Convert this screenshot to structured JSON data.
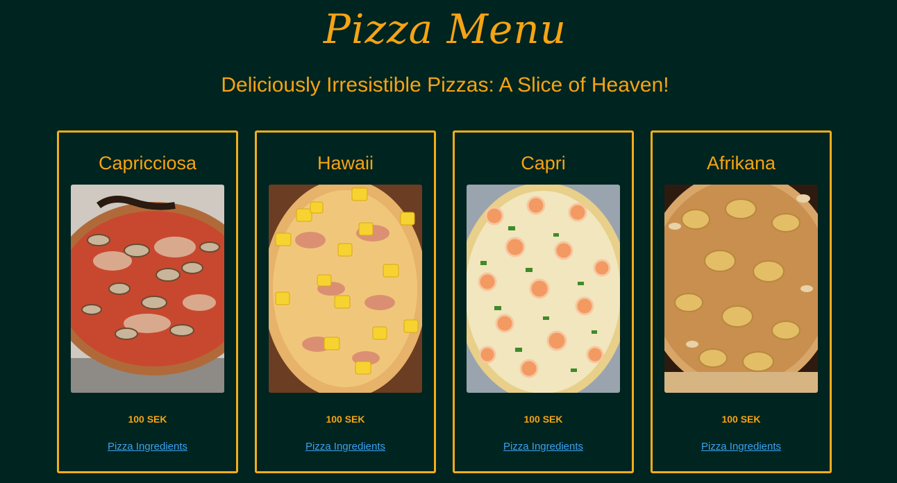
{
  "header": {
    "title": "Pizza Menu",
    "tagline": "Deliciously Irresistible Pizzas: A Slice of Heaven!"
  },
  "colors": {
    "background": "#00241f",
    "accent": "#f5a414",
    "link": "#3aa2f2"
  },
  "pizzas": [
    {
      "name": "Capricciosa",
      "price": "100 SEK",
      "link_label": "Pizza Ingredients",
      "image_icon": "capricciosa-pizza-photo"
    },
    {
      "name": "Hawaii",
      "price": "100 SEK",
      "link_label": "Pizza Ingredients",
      "image_icon": "hawaii-pizza-photo"
    },
    {
      "name": "Capri",
      "price": "100 SEK",
      "link_label": "Pizza Ingredients",
      "image_icon": "capri-pizza-photo"
    },
    {
      "name": "Afrikana",
      "price": "100 SEK",
      "link_label": "Pizza Ingredients",
      "image_icon": "afrikana-pizza-photo"
    }
  ]
}
